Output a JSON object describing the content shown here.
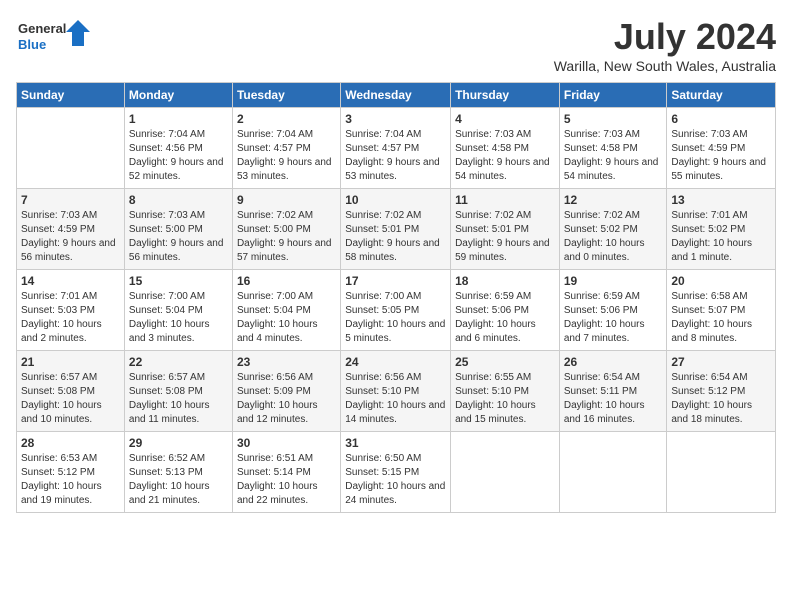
{
  "logo": {
    "line1": "General",
    "line2": "Blue"
  },
  "title": "July 2024",
  "location": "Warilla, New South Wales, Australia",
  "days_of_week": [
    "Sunday",
    "Monday",
    "Tuesday",
    "Wednesday",
    "Thursday",
    "Friday",
    "Saturday"
  ],
  "weeks": [
    [
      {
        "day": "",
        "sunrise": "",
        "sunset": "",
        "daylight": ""
      },
      {
        "day": "1",
        "sunrise": "Sunrise: 7:04 AM",
        "sunset": "Sunset: 4:56 PM",
        "daylight": "Daylight: 9 hours and 52 minutes."
      },
      {
        "day": "2",
        "sunrise": "Sunrise: 7:04 AM",
        "sunset": "Sunset: 4:57 PM",
        "daylight": "Daylight: 9 hours and 53 minutes."
      },
      {
        "day": "3",
        "sunrise": "Sunrise: 7:04 AM",
        "sunset": "Sunset: 4:57 PM",
        "daylight": "Daylight: 9 hours and 53 minutes."
      },
      {
        "day": "4",
        "sunrise": "Sunrise: 7:03 AM",
        "sunset": "Sunset: 4:58 PM",
        "daylight": "Daylight: 9 hours and 54 minutes."
      },
      {
        "day": "5",
        "sunrise": "Sunrise: 7:03 AM",
        "sunset": "Sunset: 4:58 PM",
        "daylight": "Daylight: 9 hours and 54 minutes."
      },
      {
        "day": "6",
        "sunrise": "Sunrise: 7:03 AM",
        "sunset": "Sunset: 4:59 PM",
        "daylight": "Daylight: 9 hours and 55 minutes."
      }
    ],
    [
      {
        "day": "7",
        "sunrise": "Sunrise: 7:03 AM",
        "sunset": "Sunset: 4:59 PM",
        "daylight": "Daylight: 9 hours and 56 minutes."
      },
      {
        "day": "8",
        "sunrise": "Sunrise: 7:03 AM",
        "sunset": "Sunset: 5:00 PM",
        "daylight": "Daylight: 9 hours and 56 minutes."
      },
      {
        "day": "9",
        "sunrise": "Sunrise: 7:02 AM",
        "sunset": "Sunset: 5:00 PM",
        "daylight": "Daylight: 9 hours and 57 minutes."
      },
      {
        "day": "10",
        "sunrise": "Sunrise: 7:02 AM",
        "sunset": "Sunset: 5:01 PM",
        "daylight": "Daylight: 9 hours and 58 minutes."
      },
      {
        "day": "11",
        "sunrise": "Sunrise: 7:02 AM",
        "sunset": "Sunset: 5:01 PM",
        "daylight": "Daylight: 9 hours and 59 minutes."
      },
      {
        "day": "12",
        "sunrise": "Sunrise: 7:02 AM",
        "sunset": "Sunset: 5:02 PM",
        "daylight": "Daylight: 10 hours and 0 minutes."
      },
      {
        "day": "13",
        "sunrise": "Sunrise: 7:01 AM",
        "sunset": "Sunset: 5:02 PM",
        "daylight": "Daylight: 10 hours and 1 minute."
      }
    ],
    [
      {
        "day": "14",
        "sunrise": "Sunrise: 7:01 AM",
        "sunset": "Sunset: 5:03 PM",
        "daylight": "Daylight: 10 hours and 2 minutes."
      },
      {
        "day": "15",
        "sunrise": "Sunrise: 7:00 AM",
        "sunset": "Sunset: 5:04 PM",
        "daylight": "Daylight: 10 hours and 3 minutes."
      },
      {
        "day": "16",
        "sunrise": "Sunrise: 7:00 AM",
        "sunset": "Sunset: 5:04 PM",
        "daylight": "Daylight: 10 hours and 4 minutes."
      },
      {
        "day": "17",
        "sunrise": "Sunrise: 7:00 AM",
        "sunset": "Sunset: 5:05 PM",
        "daylight": "Daylight: 10 hours and 5 minutes."
      },
      {
        "day": "18",
        "sunrise": "Sunrise: 6:59 AM",
        "sunset": "Sunset: 5:06 PM",
        "daylight": "Daylight: 10 hours and 6 minutes."
      },
      {
        "day": "19",
        "sunrise": "Sunrise: 6:59 AM",
        "sunset": "Sunset: 5:06 PM",
        "daylight": "Daylight: 10 hours and 7 minutes."
      },
      {
        "day": "20",
        "sunrise": "Sunrise: 6:58 AM",
        "sunset": "Sunset: 5:07 PM",
        "daylight": "Daylight: 10 hours and 8 minutes."
      }
    ],
    [
      {
        "day": "21",
        "sunrise": "Sunrise: 6:57 AM",
        "sunset": "Sunset: 5:08 PM",
        "daylight": "Daylight: 10 hours and 10 minutes."
      },
      {
        "day": "22",
        "sunrise": "Sunrise: 6:57 AM",
        "sunset": "Sunset: 5:08 PM",
        "daylight": "Daylight: 10 hours and 11 minutes."
      },
      {
        "day": "23",
        "sunrise": "Sunrise: 6:56 AM",
        "sunset": "Sunset: 5:09 PM",
        "daylight": "Daylight: 10 hours and 12 minutes."
      },
      {
        "day": "24",
        "sunrise": "Sunrise: 6:56 AM",
        "sunset": "Sunset: 5:10 PM",
        "daylight": "Daylight: 10 hours and 14 minutes."
      },
      {
        "day": "25",
        "sunrise": "Sunrise: 6:55 AM",
        "sunset": "Sunset: 5:10 PM",
        "daylight": "Daylight: 10 hours and 15 minutes."
      },
      {
        "day": "26",
        "sunrise": "Sunrise: 6:54 AM",
        "sunset": "Sunset: 5:11 PM",
        "daylight": "Daylight: 10 hours and 16 minutes."
      },
      {
        "day": "27",
        "sunrise": "Sunrise: 6:54 AM",
        "sunset": "Sunset: 5:12 PM",
        "daylight": "Daylight: 10 hours and 18 minutes."
      }
    ],
    [
      {
        "day": "28",
        "sunrise": "Sunrise: 6:53 AM",
        "sunset": "Sunset: 5:12 PM",
        "daylight": "Daylight: 10 hours and 19 minutes."
      },
      {
        "day": "29",
        "sunrise": "Sunrise: 6:52 AM",
        "sunset": "Sunset: 5:13 PM",
        "daylight": "Daylight: 10 hours and 21 minutes."
      },
      {
        "day": "30",
        "sunrise": "Sunrise: 6:51 AM",
        "sunset": "Sunset: 5:14 PM",
        "daylight": "Daylight: 10 hours and 22 minutes."
      },
      {
        "day": "31",
        "sunrise": "Sunrise: 6:50 AM",
        "sunset": "Sunset: 5:15 PM",
        "daylight": "Daylight: 10 hours and 24 minutes."
      },
      {
        "day": "",
        "sunrise": "",
        "sunset": "",
        "daylight": ""
      },
      {
        "day": "",
        "sunrise": "",
        "sunset": "",
        "daylight": ""
      },
      {
        "day": "",
        "sunrise": "",
        "sunset": "",
        "daylight": ""
      }
    ]
  ]
}
